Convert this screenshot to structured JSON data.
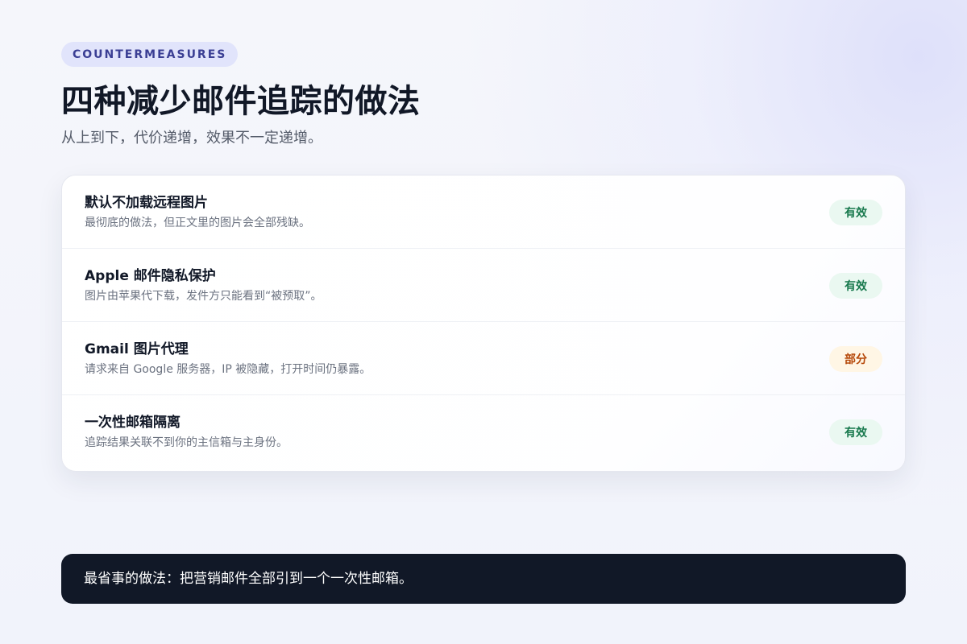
{
  "eyebrow": "COUNTERMEASURES",
  "title": "四种减少邮件追踪的做法",
  "subtitle": "从上到下，代价递增，效果不一定递增。",
  "measures": [
    {
      "title": "默认不加载远程图片",
      "description": "最彻底的做法，但正文里的图片会全部残缺。",
      "status": "有效",
      "status_color": "#16784c",
      "status_bg": "#eaf8f1"
    },
    {
      "title": "Apple 邮件隐私保护",
      "description": "图片由苹果代下载，发件方只能看到“被预取”。",
      "status": "有效",
      "status_color": "#16784c",
      "status_bg": "#eaf8f1"
    },
    {
      "title": "Gmail 图片代理",
      "description": "请求来自 Google 服务器，IP 被隐藏，打开时间仍暴露。",
      "status": "部分",
      "status_color": "#b54708",
      "status_bg": "#fff6e5"
    },
    {
      "title": "一次性邮箱隔离",
      "description": "追踪结果关联不到你的主信箱与主身份。",
      "status": "有效",
      "status_color": "#16784c",
      "status_bg": "#eaf8f1"
    }
  ],
  "footer": {
    "text": "最省事的做法：把营销邮件全部引到一个一次性邮箱。"
  }
}
